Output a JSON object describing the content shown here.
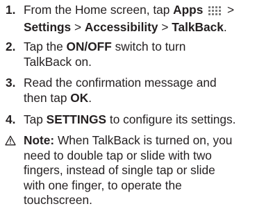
{
  "steps": [
    {
      "number": "1.",
      "lines": [
        {
          "prefix": "From the Home screen, tap ",
          "apps": "Apps",
          "suffix": " >"
        },
        {
          "settings": "Settings",
          "sep1": " > ",
          "accessibility": "Accessibility",
          "sep2": " > ",
          "talkback": "TalkBack",
          "end": "."
        }
      ]
    },
    {
      "number": "2.",
      "text_before": "Tap the ",
      "switch_label": "ON/OFF",
      "text_after": " switch to turn",
      "line2": "TalkBack on."
    },
    {
      "number": "3.",
      "line1": "Read the confirmation message and",
      "line2_before": "then tap ",
      "ok_label": "OK",
      "line2_after": "."
    },
    {
      "number": "4.",
      "text_before": "Tap ",
      "settings_label": "SETTINGS",
      "text_after": " to configure its settings."
    }
  ],
  "note": {
    "icon": "warning-triangle-icon",
    "label": "Note:",
    "line1": " When TalkBack is turned on, you",
    "line2": "need to double tap or slide with two",
    "line3": "fingers, instead of single tap or slide",
    "line4": "with one finger, to operate the",
    "line5": "touchscreen."
  },
  "apps_icon_name": "apps-grid-icon"
}
